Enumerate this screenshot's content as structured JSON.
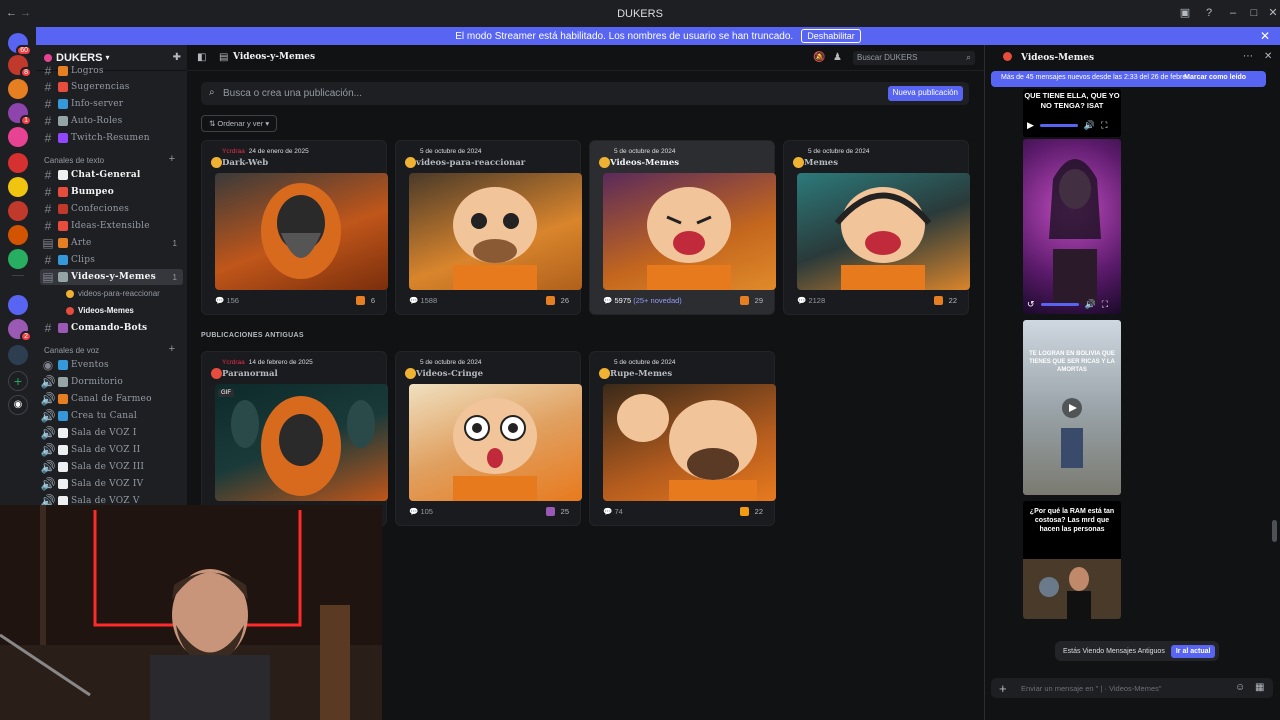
{
  "window": {
    "title": "DUKERS"
  },
  "banner": {
    "text": "El modo Streamer está habilitado. Los nombres de usuario se han truncado.",
    "button": "Deshabilitar"
  },
  "guilds": [
    {
      "color": "#5865f2",
      "badge": "60"
    },
    {
      "color": "#c0392b",
      "badge": "8"
    },
    {
      "color": "#8e44ad",
      "badge": "1"
    },
    {
      "color": "#e67e22",
      "badge": "2"
    },
    {
      "color": "#16a085",
      "badge": ""
    },
    {
      "color": "#f1c40f",
      "badge": ""
    },
    {
      "color": "#e74c3c",
      "badge": ""
    },
    {
      "color": "#2980b9",
      "badge": ""
    },
    {
      "color": "#d35400",
      "badge": ""
    }
  ],
  "server": {
    "name": "DUKERS"
  },
  "sidebar": {
    "top_channels": [
      {
        "label": "Logros",
        "color": "#e67e22"
      },
      {
        "label": "Sugerencias",
        "color": "#e74c3c"
      },
      {
        "label": "Info-server",
        "color": "#3498db"
      },
      {
        "label": "Auto-Roles",
        "color": "#95a5a6"
      },
      {
        "label": "Twitch-Resumen",
        "color": "#9146ff"
      }
    ],
    "text_category": "Canales de texto",
    "text_channels": [
      {
        "label": "Chat-General",
        "color": "#ecf0f1",
        "bold": true,
        "count": ""
      },
      {
        "label": "Bumpeo",
        "color": "#e74c3c",
        "bold": true,
        "count": ""
      },
      {
        "label": "Confeciones",
        "color": "#c0392b",
        "bold": false,
        "count": ""
      },
      {
        "label": "Ideas-Extensible",
        "color": "#e74c3c",
        "bold": false,
        "count": ""
      },
      {
        "label": "Arte",
        "color": "#e67e22",
        "bold": false,
        "count": "1"
      },
      {
        "label": "Clips",
        "color": "#3498db",
        "bold": false,
        "count": ""
      },
      {
        "label": "Videos-y-Memes",
        "color": "#95a5a6",
        "bold": true,
        "count": "1"
      }
    ],
    "threads": [
      {
        "label": "videos-para-reaccionar",
        "selected": false
      },
      {
        "label": "Videos-Memes",
        "selected": true
      }
    ],
    "bot_channel": {
      "label": "Comando-Bots",
      "color": "#9b59b6"
    },
    "voice_category": "Canales de voz",
    "voice_channels": [
      "Eventos",
      "Dormitorio",
      "Canal de Farmeo",
      "Crea tu Canal",
      "Sala de VOZ I",
      "Sala de VOZ II",
      "Sala de VOZ III",
      "Sala de VOZ IV",
      "Sala de VOZ V"
    ]
  },
  "header": {
    "channel": "Videos-y-Memes",
    "search_placeholder": "Buscar DUKERS"
  },
  "forum": {
    "search_placeholder": "Busca o crea una publicación...",
    "new_post": "Nueva publicación",
    "sort": "Ordenar y ver",
    "old_label": "PUBLICACIONES ANTIGUAS",
    "posts": [
      {
        "author": "Ycrdraa",
        "date": "24 de enero de 2025",
        "title": "Dark-Web",
        "messages": "156",
        "novelty": "",
        "reactions": "6",
        "bg": "#c0561a"
      },
      {
        "author": "",
        "date": "5 de octubre de 2024",
        "title": "videos-para-reaccionar",
        "messages": "1588",
        "novelty": "",
        "reactions": "26",
        "bg": "#d9852c"
      },
      {
        "author": "",
        "date": "5 de octubre de 2024",
        "title": "Videos-Memes",
        "messages": "5975",
        "novelty": "(25+ novedad)",
        "reactions": "29",
        "bg": "#c4671e"
      },
      {
        "author": "",
        "date": "5 de octubre de 2024",
        "title": "Memes",
        "messages": "2128",
        "novelty": "",
        "reactions": "22",
        "bg": "#2c7a7b"
      }
    ],
    "old_posts": [
      {
        "author": "Ycrdraa",
        "date": "14 de febrero de 2025",
        "title": "Paranormal",
        "messages": "105",
        "reactions": "",
        "bg": "#1a3a3a",
        "gif": "GIF"
      },
      {
        "author": "",
        "date": "5 de octubre de 2024",
        "title": "Videos-Cringe",
        "messages": "105",
        "reactions": "25",
        "bg": "#e0a060",
        "gif": ""
      },
      {
        "author": "",
        "date": "5 de octubre de 2024",
        "title": "Rupe-Memes",
        "messages": "74",
        "reactions": "22",
        "bg": "#b45c1e",
        "gif": ""
      }
    ]
  },
  "thread_panel": {
    "title": "Videos-Memes",
    "new_messages": "Más de 45 mensajes nuevos desde las 2:33 del 26 de febre...",
    "mark_read": "Marcar como leído",
    "video1_caption": "QUE TIENE ELLA, QUE YO NO TENGA? ISAT",
    "video3_caption": "TE LOGRAN EN BOLIVIA QUE TIENES QUE SER RICAS Y LA AMORTAS",
    "video4_caption": "¿Por qué la RAM está tan costosa? Las mrd que hacen las personas",
    "old_notice": "Estás Viendo Mensajes Antiguos",
    "go_current": "Ir al actual",
    "composer_placeholder": "Enviar un mensaje en \" |  · Videos-Memes\""
  }
}
